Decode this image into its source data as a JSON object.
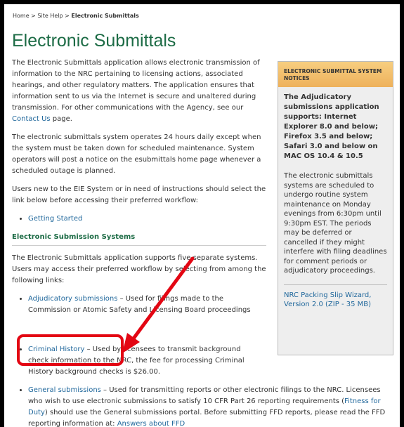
{
  "breadcrumb": {
    "home": "Home",
    "sep1": " > ",
    "site_help": "Site Help",
    "sep2": " > ",
    "current": "Electronic Submittals"
  },
  "title": "Electronic Submittals",
  "intro": {
    "p1_text": "The Electronic Submittals application allows electronic transmission of information to the NRC pertaining to licensing actions, associated hearings, and other regulatory matters. The application ensures that information sent to us via the Internet is secure and unaltered during transmission.  For other communications with the Agency, see our ",
    "p1_link": "Contact Us",
    "p1_end": " page.",
    "p2": "The electronic submittals system operates 24 hours daily except when the system must be taken down for scheduled maintenance. System operators will post a notice on the esubmittals home page whenever a scheduled outage is planned.",
    "p3": "Users new to the EIE System or in need of instructions should select the link below before accessing their preferred workflow:",
    "getting_started": "Getting Started"
  },
  "systems": {
    "heading": "Electronic Submission Systems",
    "intro": "The Electronic Submittals application supports five separate systems. Users may access their preferred workflow by selecting from among the following links:",
    "adjudicatory_link": "Adjudicatory submissions",
    "adjudicatory_text": " – Used for filings made to the Commission or Atomic Safety and Licensing Board proceedings",
    "criminal_link": "Criminal History",
    "criminal_text": " – Used by licensees to transmit background check information to the NRC, the fee for processing Criminal History background checks is $26.00.",
    "general_link": "General submissions",
    "general_text1": " – Used for transmitting reports or other electronic filings to the NRC. Licensees who wish to use electronic submissions to satisfy 10 CFR Part 26 reporting requirements (",
    "ffd_link": "Fitness for Duty",
    "general_text2": ") should use the General submissions portal. Before submitting FFD reports, please read the FFD reporting information at: ",
    "answers_link": "Answers about FFD"
  },
  "sidebar": {
    "heading": "Electronic Submittal System Notices",
    "notice": "The Adjudicatory submissions application supports: Internet Explorer 8.0 and below; Firefox 3.5 and below; Safari 3.0 and below on MAC OS 10.4 & 10.5",
    "maintenance": "The electronic submittals systems are scheduled to undergo routine system maintenance on Monday evenings from 6:30pm until 9:30pm EST. The periods may be deferred or cancelled if they might interfere with filing deadlines for comment periods or adjudicatory proceedings.",
    "packing_slip": "NRC Packing Slip Wizard, Version 2.0 (ZIP - 35 MB)"
  },
  "colors": {
    "title_green": "#1c6b45",
    "link_blue": "#21689c",
    "annotation_red": "#e30613",
    "sidebar_header": "#eeb15c"
  }
}
